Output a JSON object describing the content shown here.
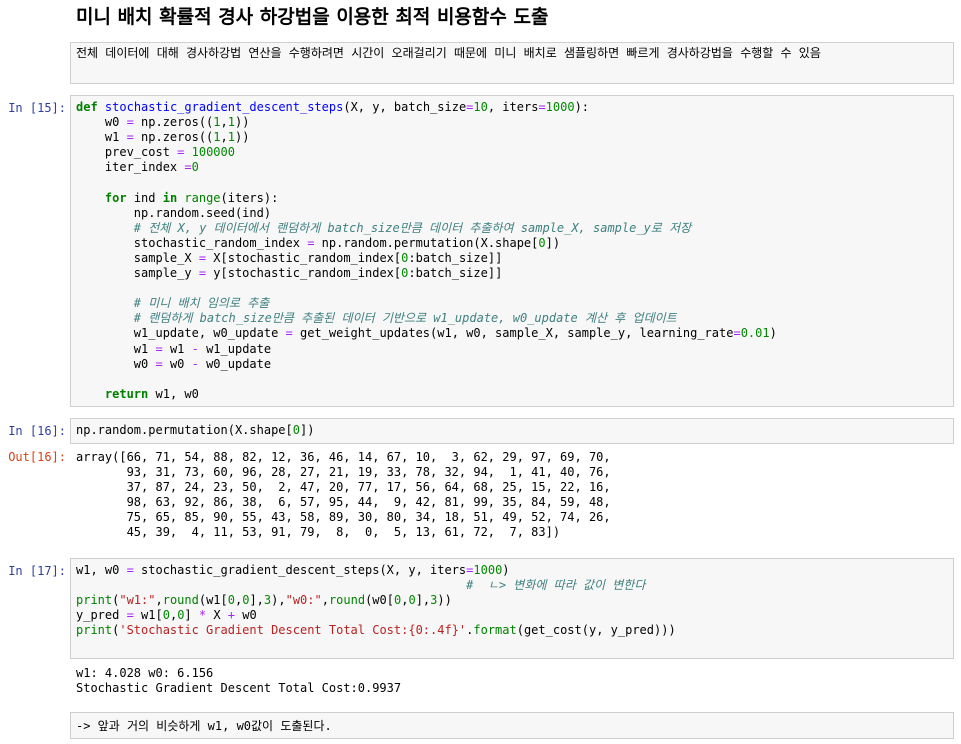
{
  "heading": "미니 배치 확률적 경사 하강법을 이용한 최적 비용함수 도출",
  "markdown_top": "전체 데이터에 대해 경사하강법 연산을 수행하려면 시간이 오래걸리기 때문에 미니 배치로 샘플링하면 빠르게 경사하강법을 수행할 수 있음",
  "cells": {
    "c15": {
      "prompt": "In [15]:"
    },
    "c16": {
      "prompt": "In [16]:",
      "out_prompt": "Out[16]:"
    },
    "c17": {
      "prompt": "In [17]:"
    }
  },
  "outputs": {
    "out16": "array([66, 71, 54, 88, 82, 12, 36, 46, 14, 67, 10,  3, 62, 29, 97, 69, 70,\n       93, 31, 73, 60, 96, 28, 27, 21, 19, 33, 78, 32, 94,  1, 41, 40, 76,\n       37, 87, 24, 23, 50,  2, 47, 20, 77, 17, 56, 64, 68, 25, 15, 22, 16,\n       98, 63, 92, 86, 38,  6, 57, 95, 44,  9, 42, 81, 99, 35, 84, 59, 48,\n       75, 65, 85, 90, 55, 43, 58, 89, 30, 80, 34, 18, 51, 49, 52, 74, 26,\n       45, 39,  4, 11, 53, 91, 79,  8,  0,  5, 13, 61, 72,  7, 83])",
    "out17": "w1: 4.028 w0: 6.156\nStochastic Gradient Descent Total Cost:0.9937"
  },
  "markdown_bottom": "-> 앞과 거의 비슷하게 w1, w0값이 도출된다.",
  "code": {
    "c15": [
      [
        [
          "k",
          "def"
        ],
        [
          "t",
          " "
        ],
        [
          "f",
          "stochastic_gradient_descent_steps"
        ],
        [
          "t",
          "(X, y, batch_size"
        ],
        [
          "o",
          "="
        ],
        [
          "n",
          "10"
        ],
        [
          "t",
          ", iters"
        ],
        [
          "o",
          "="
        ],
        [
          "n",
          "1000"
        ],
        [
          "t",
          "):"
        ]
      ],
      [
        [
          "t",
          "    w0 "
        ],
        [
          "o",
          "="
        ],
        [
          "t",
          " np.zeros(("
        ],
        [
          "n",
          "1"
        ],
        [
          "t",
          ","
        ],
        [
          "n",
          "1"
        ],
        [
          "t",
          "))"
        ]
      ],
      [
        [
          "t",
          "    w1 "
        ],
        [
          "o",
          "="
        ],
        [
          "t",
          " np.zeros(("
        ],
        [
          "n",
          "1"
        ],
        [
          "t",
          ","
        ],
        [
          "n",
          "1"
        ],
        [
          "t",
          "))"
        ]
      ],
      [
        [
          "t",
          "    prev_cost "
        ],
        [
          "o",
          "="
        ],
        [
          "t",
          " "
        ],
        [
          "n",
          "100000"
        ]
      ],
      [
        [
          "t",
          "    iter_index "
        ],
        [
          "o",
          "="
        ],
        [
          "n",
          "0"
        ]
      ],
      [
        [
          "t",
          ""
        ]
      ],
      [
        [
          "t",
          "    "
        ],
        [
          "k",
          "for"
        ],
        [
          "t",
          " ind "
        ],
        [
          "k",
          "in"
        ],
        [
          "t",
          " "
        ],
        [
          "b",
          "range"
        ],
        [
          "t",
          "(iters):"
        ]
      ],
      [
        [
          "t",
          "        np.random.seed(ind)"
        ]
      ],
      [
        [
          "t",
          "        "
        ],
        [
          "c",
          "# 전체 X, y 데이터에서 랜덤하게 batch_size만큼 데이터 추출하여 sample_X, sample_y로 저장"
        ]
      ],
      [
        [
          "t",
          "        stochastic_random_index "
        ],
        [
          "o",
          "="
        ],
        [
          "t",
          " np.random.permutation(X.shape["
        ],
        [
          "n",
          "0"
        ],
        [
          "t",
          "])"
        ]
      ],
      [
        [
          "t",
          "        sample_X "
        ],
        [
          "o",
          "="
        ],
        [
          "t",
          " X[stochastic_random_index["
        ],
        [
          "n",
          "0"
        ],
        [
          "t",
          ":batch_size]]"
        ]
      ],
      [
        [
          "t",
          "        sample_y "
        ],
        [
          "o",
          "="
        ],
        [
          "t",
          " y[stochastic_random_index["
        ],
        [
          "n",
          "0"
        ],
        [
          "t",
          ":batch_size]]"
        ]
      ],
      [
        [
          "t",
          ""
        ]
      ],
      [
        [
          "t",
          "        "
        ],
        [
          "c",
          "# 미니 배치 임의로 추출"
        ]
      ],
      [
        [
          "t",
          "        "
        ],
        [
          "c",
          "# 랜덤하게 batch_size만큼 추출된 데이터 기반으로 w1_update, w0_update 계산 후 업데이트"
        ]
      ],
      [
        [
          "t",
          "        w1_update, w0_update "
        ],
        [
          "o",
          "="
        ],
        [
          "t",
          " get_weight_updates(w1, w0, sample_X, sample_y, learning_rate"
        ],
        [
          "o",
          "="
        ],
        [
          "n",
          "0.01"
        ],
        [
          "t",
          ")"
        ]
      ],
      [
        [
          "t",
          "        w1 "
        ],
        [
          "o",
          "="
        ],
        [
          "t",
          " w1 "
        ],
        [
          "o",
          "-"
        ],
        [
          "t",
          " w1_update"
        ]
      ],
      [
        [
          "t",
          "        w0 "
        ],
        [
          "o",
          "="
        ],
        [
          "t",
          " w0 "
        ],
        [
          "o",
          "-"
        ],
        [
          "t",
          " w0_update"
        ]
      ],
      [
        [
          "t",
          ""
        ]
      ],
      [
        [
          "t",
          "    "
        ],
        [
          "k",
          "return"
        ],
        [
          "t",
          " w1, w0"
        ]
      ]
    ],
    "c16": [
      [
        [
          "t",
          "np.random.permutation(X.shape["
        ],
        [
          "n",
          "0"
        ],
        [
          "t",
          "])"
        ]
      ]
    ],
    "c17": [
      [
        [
          "t",
          "w1, w0 "
        ],
        [
          "o",
          "="
        ],
        [
          "t",
          " stochastic_gradient_descent_steps(X, y, iters"
        ],
        [
          "o",
          "="
        ],
        [
          "n",
          "1000"
        ],
        [
          "t",
          ")"
        ]
      ],
      [
        [
          "t",
          "                                                      "
        ],
        [
          "c",
          "#  ㄴ> 변화에 따라 값이 변한다"
        ]
      ],
      [
        [
          "b",
          "print"
        ],
        [
          "t",
          "("
        ],
        [
          "s",
          "\"w1:\""
        ],
        [
          "t",
          ","
        ],
        [
          "b",
          "round"
        ],
        [
          "t",
          "(w1["
        ],
        [
          "n",
          "0"
        ],
        [
          "t",
          ","
        ],
        [
          "n",
          "0"
        ],
        [
          "t",
          "],"
        ],
        [
          "n",
          "3"
        ],
        [
          "t",
          "),"
        ],
        [
          "s",
          "\"w0:\""
        ],
        [
          "t",
          ","
        ],
        [
          "b",
          "round"
        ],
        [
          "t",
          "(w0["
        ],
        [
          "n",
          "0"
        ],
        [
          "t",
          ","
        ],
        [
          "n",
          "0"
        ],
        [
          "t",
          "],"
        ],
        [
          "n",
          "3"
        ],
        [
          "t",
          "))"
        ]
      ],
      [
        [
          "t",
          "y_pred "
        ],
        [
          "o",
          "="
        ],
        [
          "t",
          " w1["
        ],
        [
          "n",
          "0"
        ],
        [
          "t",
          ","
        ],
        [
          "n",
          "0"
        ],
        [
          "t",
          "] "
        ],
        [
          "o",
          "*"
        ],
        [
          "t",
          " X "
        ],
        [
          "o",
          "+"
        ],
        [
          "t",
          " w0"
        ]
      ],
      [
        [
          "b",
          "print"
        ],
        [
          "t",
          "("
        ],
        [
          "s",
          "'Stochastic Gradient Descent Total Cost:{0:.4f}'"
        ],
        [
          "t",
          "."
        ],
        [
          "b",
          "format"
        ],
        [
          "t",
          "(get_cost(y, y_pred)))"
        ]
      ]
    ]
  }
}
